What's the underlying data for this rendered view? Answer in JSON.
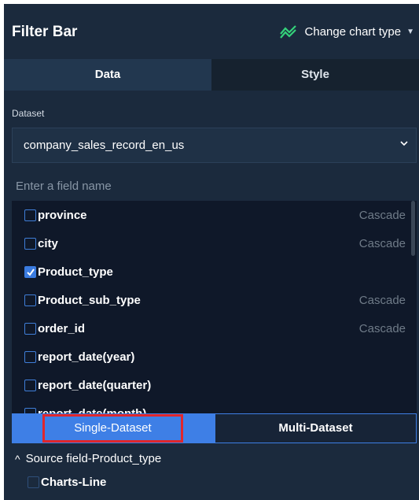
{
  "header": {
    "title": "Filter Bar",
    "chart_type_label": "Change chart type",
    "chart_type_icon": "line-chart-icon"
  },
  "tabs": [
    {
      "label": "Data",
      "active": true
    },
    {
      "label": "Style",
      "active": false
    }
  ],
  "dataset": {
    "label": "Dataset",
    "selected": "company_sales_record_en_us"
  },
  "search": {
    "placeholder": "Enter a field name"
  },
  "fields": [
    {
      "name": "province",
      "checked": false,
      "tag": "Cascade"
    },
    {
      "name": "city",
      "checked": false,
      "tag": "Cascade"
    },
    {
      "name": "Product_type",
      "checked": true,
      "tag": ""
    },
    {
      "name": "Product_sub_type",
      "checked": false,
      "tag": "Cascade"
    },
    {
      "name": "order_id",
      "checked": false,
      "tag": "Cascade"
    },
    {
      "name": "report_date(year)",
      "checked": false,
      "tag": ""
    },
    {
      "name": "report_date(quarter)",
      "checked": false,
      "tag": ""
    },
    {
      "name": "report_date(month)",
      "checked": false,
      "tag": ""
    }
  ],
  "modes": {
    "single": "Single-Dataset",
    "multi": "Multi-Dataset"
  },
  "source": {
    "label": "Source field-Product_type",
    "items": [
      {
        "name": "Charts-Line",
        "checked": false
      }
    ]
  },
  "colors": {
    "panel_bg": "#1b2a3d",
    "list_bg": "#0f1829",
    "accent": "#3e7fe6",
    "highlight": "#e1262b",
    "muted": "#6f7b88"
  }
}
